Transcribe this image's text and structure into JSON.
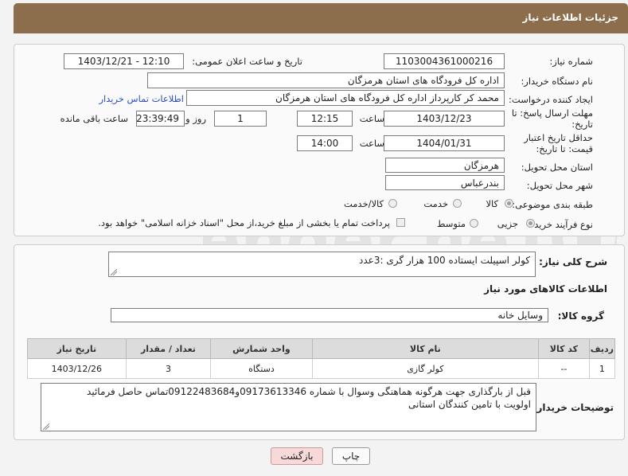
{
  "header": {
    "title": "جزئیات اطلاعات نیاز"
  },
  "form": {
    "need_number_label": "شماره نیاز:",
    "need_number": "1103004361000216",
    "announce_label": "تاریخ و ساعت اعلان عمومی:",
    "announce_value": "1403/12/21 - 12:10",
    "buyer_org_label": "نام دستگاه خریدار:",
    "buyer_org": "اداره کل فرودگاه های استان هرمزگان",
    "creator_label": "ایجاد کننده درخواست:",
    "creator": "محمد کر کارپرداز اداره کل فرودگاه های استان هرمزگان",
    "contact_link": "اطلاعات تماس خریدار",
    "deadline_label": "مهلت ارسال پاسخ: تا تاریخ:",
    "deadline_date": "1403/12/23",
    "time_label": "ساعت",
    "deadline_time": "12:15",
    "days_value": "1",
    "days_label": "روز و",
    "remaining_value": "23:39:49",
    "remaining_label": "ساعت باقی مانده",
    "validity_label": "حداقل تاریخ اعتبار قیمت: تا تاریخ:",
    "validity_date": "1404/01/31",
    "validity_time": "14:00",
    "province_label": "استان محل تحویل:",
    "province": "هرمزگان",
    "city_label": "شهر محل تحویل:",
    "city": "بندرعباس",
    "category_label": "طبقه بندی موضوعی:",
    "category_options": [
      "کالا",
      "خدمت",
      "کالا/خدمت"
    ],
    "process_label": "نوع فرآیند خرید :",
    "process_options": [
      "جزیی",
      "متوسط"
    ],
    "payment_note": "پرداخت تمام یا بخشی از مبلغ خرید،از محل \"اسناد خزانه اسلامی\" خواهد بود."
  },
  "details": {
    "description_label": "شرح کلی نیاز:",
    "description": "کولر اسپیلت ایستاده 100 هزار گری :3عدد",
    "goods_info_title": "اطلاعات کالاهای مورد نیاز",
    "group_label": "گروه کالا:",
    "group_value": "وسایل خانه",
    "table": {
      "headers": [
        "ردیف",
        "کد کالا",
        "نام کالا",
        "واحد شمارش",
        "تعداد / مقدار",
        "تاریخ نیاز"
      ],
      "rows": [
        [
          "1",
          "--",
          "کولر گازی",
          "دستگاه",
          "3",
          "1403/12/26"
        ]
      ]
    },
    "buyer_notes_label": "توضیحات خریدار:",
    "buyer_notes_line1": "قبل از بارگذاری جهت هرگونه هماهنگی وسوال با شماره 09173613346و09122483684تماس حاصل فرمائید",
    "buyer_notes_line2": "اولویت با تامین کنندگان استانی"
  },
  "buttons": {
    "print": "چاپ",
    "back": "بازگشت"
  },
  "watermark": "AriaTender.neT",
  "colors": {
    "header": "#8c6e4c",
    "link": "#2e4fbf",
    "back_button": "#f7d9d9"
  }
}
